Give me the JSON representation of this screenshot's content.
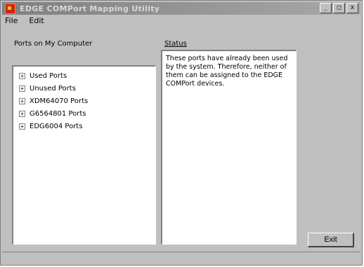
{
  "window": {
    "title": "EDGE COMPort Mapping Utility",
    "controls": [
      "_",
      "□",
      "x"
    ]
  },
  "menu": {
    "items": [
      "File",
      "Edit"
    ]
  },
  "labels": {
    "ports": "Ports on My Computer",
    "status": "Status"
  },
  "tree": {
    "items": [
      {
        "expander": "+",
        "label": "Used Ports"
      },
      {
        "expander": "+",
        "label": "Unused Ports"
      },
      {
        "expander": "+",
        "label": "XDM64070 Ports"
      },
      {
        "expander": "+",
        "label": "G6564801 Ports"
      },
      {
        "expander": "+",
        "label": "EDG6004 Ports"
      }
    ]
  },
  "status": {
    "text": "These ports have already been used by the system. Therefore, neither of them can be assigned to the EDGE COMPort devices."
  },
  "buttons": {
    "exit": "Exit"
  }
}
